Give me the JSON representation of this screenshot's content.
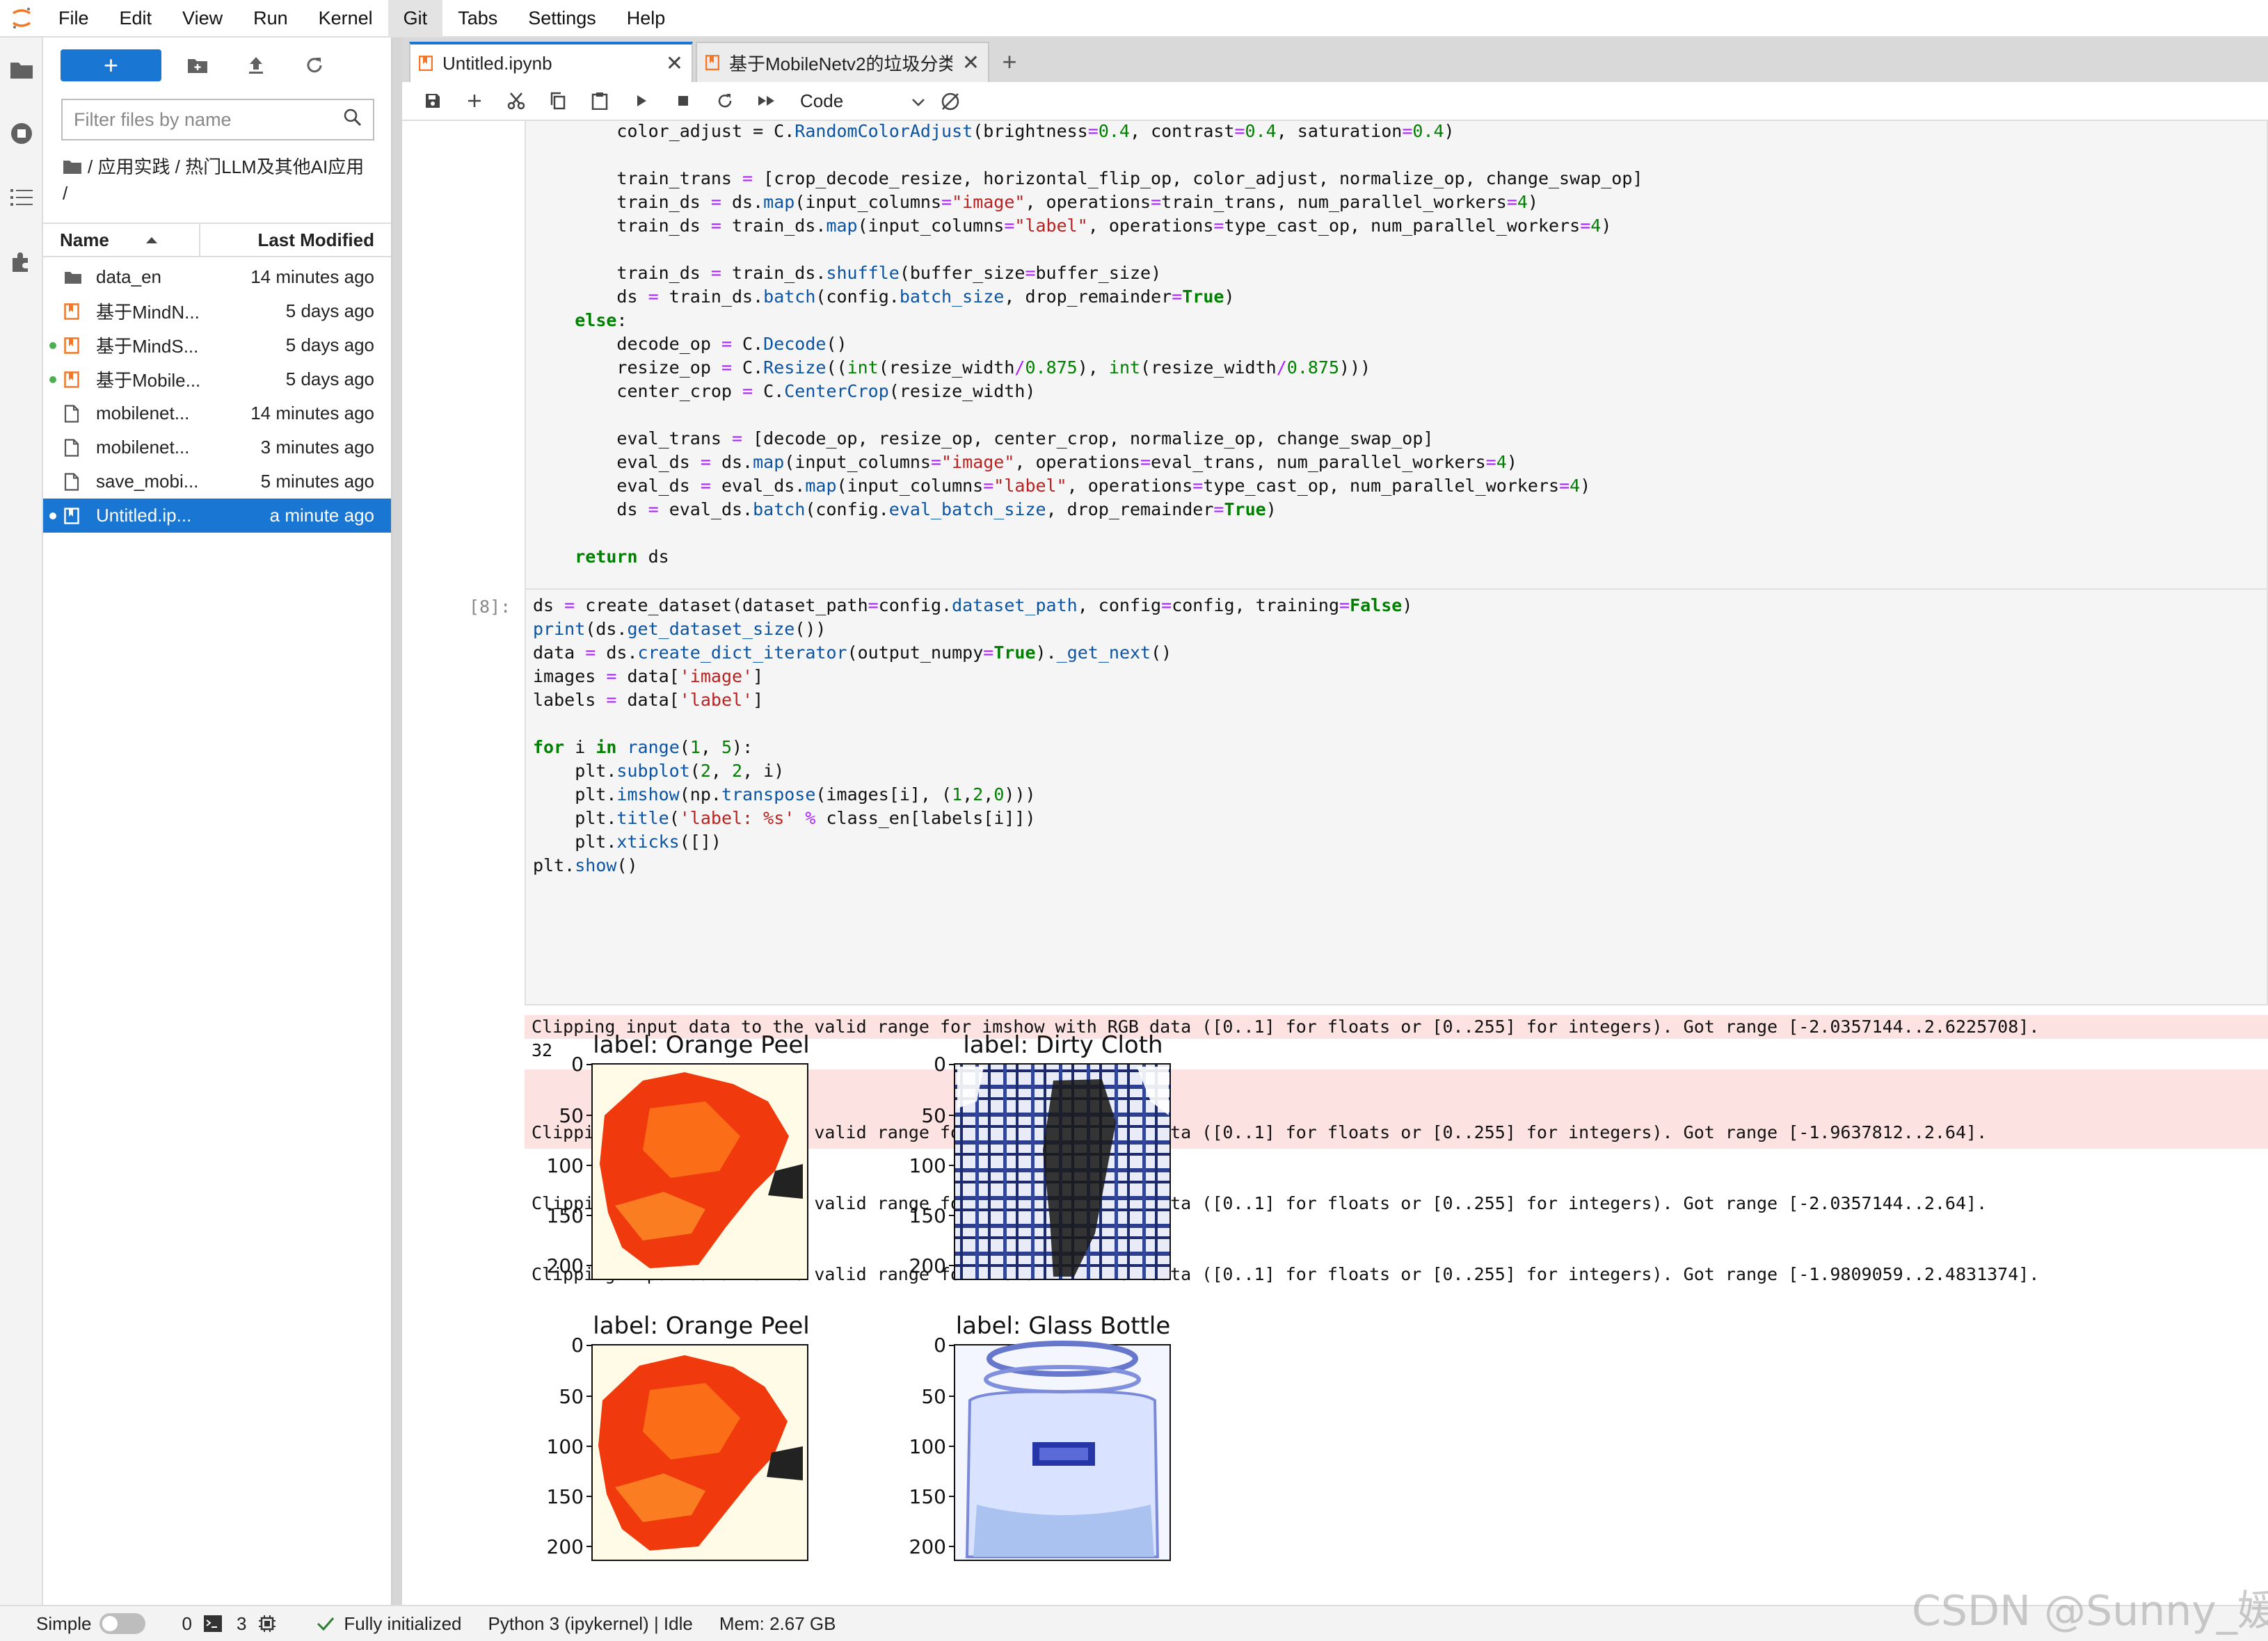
{
  "menu": {
    "items": [
      "File",
      "Edit",
      "View",
      "Run",
      "Kernel",
      "Git",
      "Tabs",
      "Settings",
      "Help"
    ],
    "active": "Git"
  },
  "file_browser": {
    "new_button_label": "+",
    "filter_placeholder": "Filter files by name",
    "breadcrumb": "/ 应用实践 / 热门LLM及其他AI应用 /",
    "col_name": "Name",
    "col_modified": "Last Modified",
    "files": [
      {
        "name": "data_en",
        "modified": "14 minutes ago",
        "type": "folder",
        "running": false,
        "selected": false
      },
      {
        "name": "基于MindN...",
        "modified": "5 days ago",
        "type": "notebook",
        "running": false,
        "selected": false
      },
      {
        "name": "基于MindS...",
        "modified": "5 days ago",
        "type": "notebook",
        "running": true,
        "selected": false
      },
      {
        "name": "基于Mobile...",
        "modified": "5 days ago",
        "type": "notebook",
        "running": true,
        "selected": false
      },
      {
        "name": "mobilenet...",
        "modified": "14 minutes ago",
        "type": "file",
        "running": false,
        "selected": false
      },
      {
        "name": "mobilenet...",
        "modified": "3 minutes ago",
        "type": "file",
        "running": false,
        "selected": false
      },
      {
        "name": "save_mobi...",
        "modified": "5 minutes ago",
        "type": "file",
        "running": false,
        "selected": false
      },
      {
        "name": "Untitled.ip...",
        "modified": "a minute ago",
        "type": "notebook",
        "running": true,
        "selected": true
      }
    ]
  },
  "tabs": [
    {
      "label": "Untitled.ipynb",
      "active": true
    },
    {
      "label": "基于MobileNetv2的垃圾分类",
      "active": false
    }
  ],
  "toolbar": {
    "cell_type": "Code"
  },
  "cell_prompt": "[8]:",
  "outputs": {
    "stderr1": "Clipping input data to the valid range for imshow with RGB data ([0..1] for floats or [0..255] for integers). Got range [-2.0357144..2.6225708].",
    "stdout1": "32",
    "stderr2": [
      "Clipping input data to the valid range for imshow with RGB data ([0..1] for floats or [0..255] for integers). Got range [-1.9637812..2.64].",
      "Clipping input data to the valid range for imshow with RGB data ([0..1] for floats or [0..255] for integers). Got range [-2.0357144..2.64].",
      "Clipping input data to the valid range for imshow with RGB data ([0..1] for floats or [0..255] for integers). Got range [-1.9809059..2.4831374]."
    ]
  },
  "plot": {
    "subplot_titles": [
      "label: Orange Peel",
      "label: Dirty Cloth",
      "label: Orange Peel",
      "label: Glass Bottle"
    ],
    "yticks": [
      "0",
      "50",
      "100",
      "150",
      "200"
    ]
  },
  "status": {
    "mode": "Simple",
    "terminals": "0",
    "kernels": "3",
    "init": "Fully initialized",
    "kernel": "Python 3 (ipykernel) | Idle",
    "mem": "Mem: 2.67 GB"
  },
  "watermark": "CSDN @Sunny_媛"
}
